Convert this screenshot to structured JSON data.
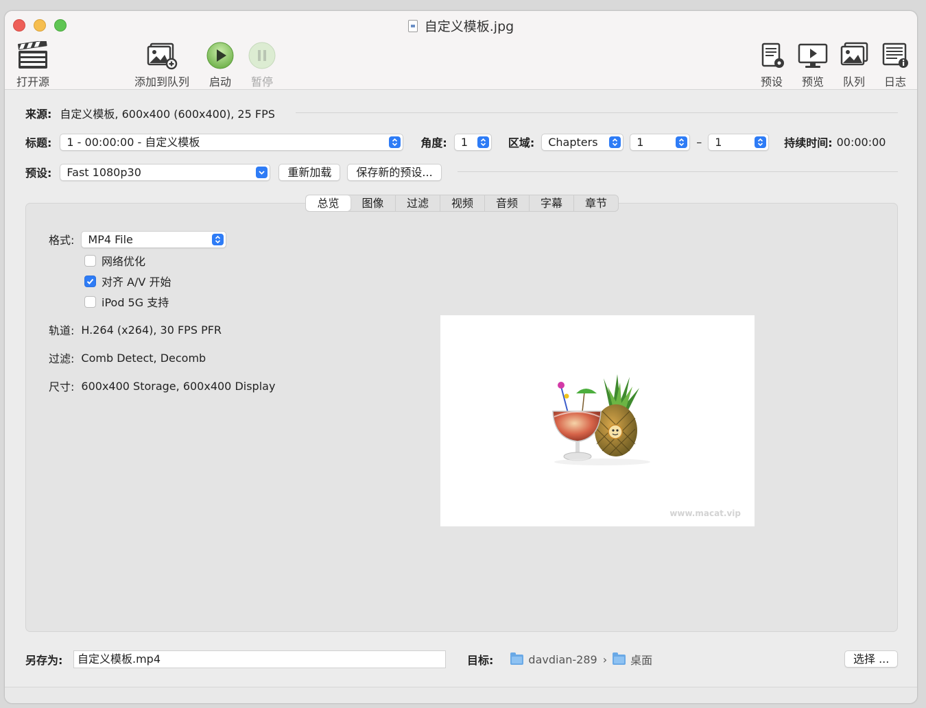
{
  "window": {
    "title": "自定义模板.jpg"
  },
  "toolbar": {
    "open_source": "打开源",
    "add_to_queue": "添加到队列",
    "start": "启动",
    "pause": "暂停",
    "presets": "预设",
    "preview": "预览",
    "queue": "队列",
    "log": "日志"
  },
  "source": {
    "label": "来源:",
    "value": "自定义模板, 600x400 (600x400), 25 FPS"
  },
  "title_row": {
    "title_label": "标题:",
    "title_value": "1 - 00:00:00 - 自定义模板",
    "angle_label": "角度:",
    "angle_value": "1",
    "range_label": "区域:",
    "range_type": "Chapters",
    "range_start": "1",
    "range_dash": "–",
    "range_end": "1",
    "duration_label": "持续时间:",
    "duration_value": "00:00:00"
  },
  "preset_row": {
    "label": "预设:",
    "value": "Fast 1080p30",
    "reload_button": "重新加载",
    "save_new_button": "保存新的预设..."
  },
  "tabs": [
    {
      "label": "总览",
      "active": true
    },
    {
      "label": "图像",
      "active": false
    },
    {
      "label": "过滤",
      "active": false
    },
    {
      "label": "视频",
      "active": false
    },
    {
      "label": "音频",
      "active": false
    },
    {
      "label": "字幕",
      "active": false
    },
    {
      "label": "章节",
      "active": false
    }
  ],
  "summary": {
    "format_label": "格式:",
    "format_value": "MP4 File",
    "options": [
      {
        "label": "网络优化",
        "checked": false
      },
      {
        "label": "对齐 A/V 开始",
        "checked": true
      },
      {
        "label": "iPod 5G 支持",
        "checked": false
      }
    ],
    "tracks_label": "轨道:",
    "tracks_value": "H.264 (x264), 30 FPS PFR",
    "filters_label": "过滤:",
    "filters_value": "Comb Detect, Decomb",
    "size_label": "尺寸:",
    "size_value": "600x400 Storage, 600x400 Display",
    "preview_watermark": "www.macat.vip"
  },
  "bottom": {
    "save_as_label": "另存为:",
    "save_as_value": "自定义模板.mp4",
    "destination_label": "目标:",
    "destination_folder": "davdian-289",
    "destination_chevron": "›",
    "destination_subfolder": "桌面",
    "choose_button": "选择 ..."
  },
  "colors": {
    "accent": "#2e7cf6",
    "close": "#ee5f58",
    "minimize": "#f6be4f",
    "zoom": "#5fc553"
  }
}
